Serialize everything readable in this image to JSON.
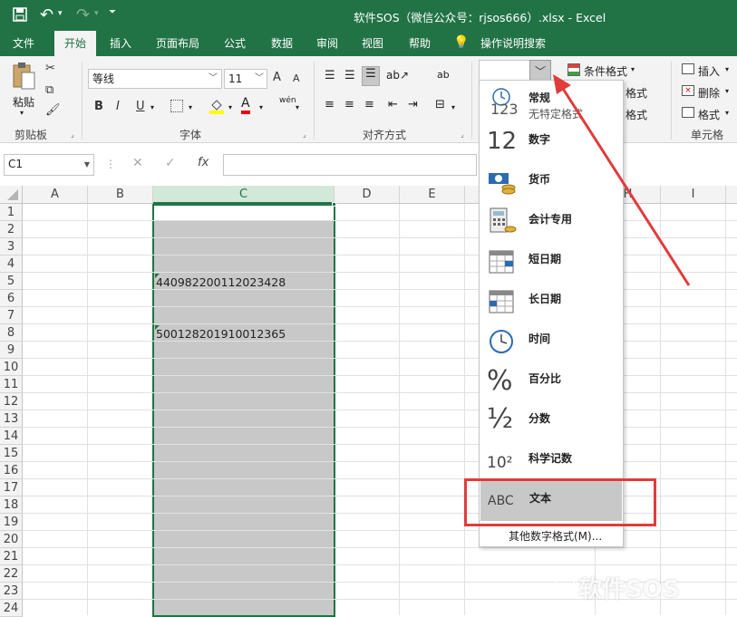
{
  "window": {
    "title": "软件SOS（微信公众号：rjsos666）.xlsx  -  Excel"
  },
  "tabs": [
    "文件",
    "开始",
    "插入",
    "页面布局",
    "公式",
    "数据",
    "审阅",
    "视图",
    "帮助",
    "操作说明搜索"
  ],
  "ribbon": {
    "clipboard": {
      "paste": "粘贴",
      "label": "剪贴板"
    },
    "font": {
      "name": "等线",
      "size": "11",
      "label": "字体",
      "bold": "B",
      "italic": "I",
      "underline": "U",
      "grow": "A",
      "shrink": "A",
      "color_a": "A",
      "phonetic": "wén"
    },
    "alignment": {
      "label": "对齐方式",
      "wrap": "ab"
    },
    "number": {
      "format_value": ""
    },
    "styles": {
      "conditional": "条件格式",
      "table_format": "格式",
      "cell_styles": "格式"
    },
    "cells": {
      "insert": "插入",
      "delete": "删除",
      "format": "格式",
      "label": "单元格"
    }
  },
  "formula_bar": {
    "name_box": "C1",
    "fx": "fx",
    "value": ""
  },
  "columns": [
    "A",
    "B",
    "C",
    "D",
    "E",
    "H",
    "I"
  ],
  "rows": [
    "1",
    "2",
    "3",
    "4",
    "5",
    "6",
    "7",
    "8",
    "9",
    "10",
    "11",
    "12",
    "13",
    "14",
    "15",
    "16",
    "17",
    "18",
    "19",
    "20",
    "21",
    "22",
    "23",
    "24"
  ],
  "cells": {
    "C5": "440982200112023428",
    "C8": "500128201910012365"
  },
  "number_format_menu": {
    "items": [
      {
        "label": "常规",
        "sub": "无特定格式",
        "icon": "general-123-icon",
        "icon_text": "123"
      },
      {
        "label": "数字",
        "sub": "",
        "icon": "number-12-icon",
        "icon_text": "12"
      },
      {
        "label": "货币",
        "sub": "",
        "icon": "currency-icon",
        "icon_text": ""
      },
      {
        "label": "会计专用",
        "sub": "",
        "icon": "accounting-icon",
        "icon_text": ""
      },
      {
        "label": "短日期",
        "sub": "",
        "icon": "short-date-icon",
        "icon_text": ""
      },
      {
        "label": "长日期",
        "sub": "",
        "icon": "long-date-icon",
        "icon_text": ""
      },
      {
        "label": "时间",
        "sub": "",
        "icon": "clock-icon",
        "icon_text": ""
      },
      {
        "label": "百分比",
        "sub": "",
        "icon": "percent-icon",
        "icon_text": "%"
      },
      {
        "label": "分数",
        "sub": "",
        "icon": "fraction-icon",
        "icon_text": "½"
      },
      {
        "label": "科学记数",
        "sub": "",
        "icon": "scientific-icon",
        "icon_text": "10²"
      },
      {
        "label": "文本",
        "sub": "",
        "icon": "text-abc-icon",
        "icon_text": "ABC"
      }
    ],
    "more": "其他数字格式(M)..."
  },
  "watermark": "软件SOS",
  "colors": {
    "excel_green": "#217346",
    "selection_gray": "#c6c6c6",
    "annotation_red": "#e03c3c",
    "highlight": "#c8c8c8"
  }
}
